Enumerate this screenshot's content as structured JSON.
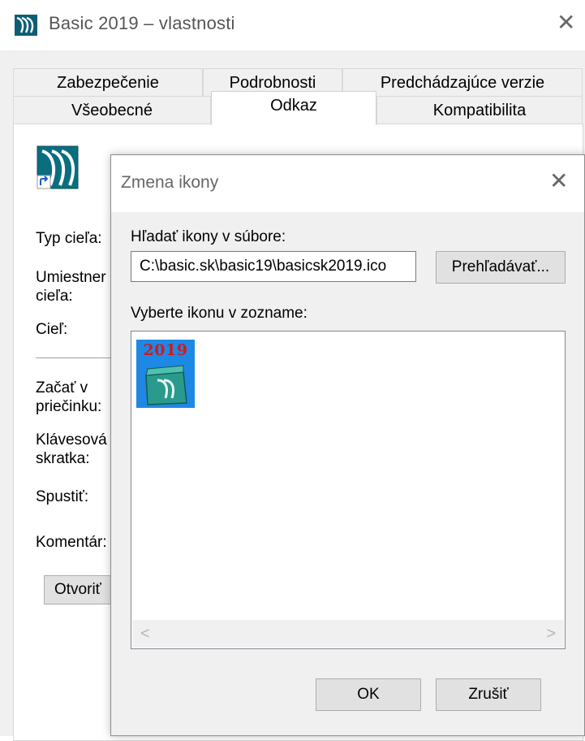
{
  "window": {
    "title": "Basic 2019 – vlastnosti",
    "close": "✕"
  },
  "tabs": {
    "row1": [
      "Zabezpečenie",
      "Podrobnosti",
      "Predchádzajúce verzie"
    ],
    "row2": [
      "Všeobecné",
      "Odkaz",
      "Kompatibilita"
    ],
    "active": "Odkaz"
  },
  "panel": {
    "labels": {
      "target_type": "Typ cieľa:",
      "target_location_1": "Umiestner",
      "target_location_2": "cieľa:",
      "target": "Cieľ:",
      "start_in_1": "Začať v",
      "start_in_2": "priečinku:",
      "hotkey_1": "Klávesová",
      "hotkey_2": "skratka:",
      "run": "Spustiť:",
      "comment": "Komentár:"
    },
    "open_button": "Otvoriť"
  },
  "dialog": {
    "title": "Zmena ikony",
    "close": "✕",
    "search_label": "Hľadať ikony v súbore:",
    "path_value": "C:\\basic.sk\\basic19\\basicsk2019.ico",
    "browse_button": "Prehľadávať...",
    "list_label": "Vyberte ikonu v zozname:",
    "icon_text": "2019",
    "scroll_left": "<",
    "scroll_right": ">",
    "ok_button": "OK",
    "cancel_button": "Zrušiť"
  },
  "colors": {
    "icon_bg": "#1e88e5",
    "icon_text": "#d11a1a",
    "brand_teal": "#0a6e80"
  }
}
